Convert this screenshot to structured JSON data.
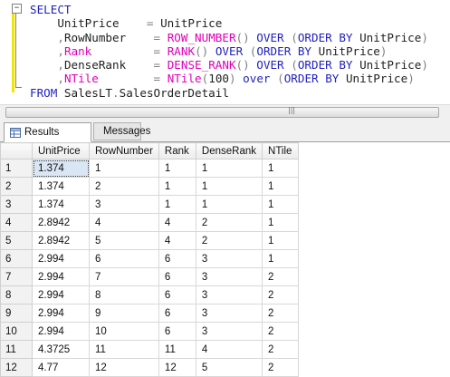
{
  "editor": {
    "lines": [
      [
        {
          "c": "kw",
          "t": "SELECT"
        }
      ],
      [
        {
          "c": "tx",
          "t": "    UnitPrice    "
        },
        {
          "c": "op",
          "t": "="
        },
        {
          "c": "tx",
          "t": " UnitPrice"
        }
      ],
      [
        {
          "c": "tx",
          "t": "    "
        },
        {
          "c": "op",
          "t": ","
        },
        {
          "c": "tx",
          "t": "RowNumber    "
        },
        {
          "c": "op",
          "t": "="
        },
        {
          "c": "tx",
          "t": " "
        },
        {
          "c": "fn",
          "t": "ROW_NUMBER"
        },
        {
          "c": "op",
          "t": "()"
        },
        {
          "c": "tx",
          "t": " "
        },
        {
          "c": "kw",
          "t": "OVER"
        },
        {
          "c": "tx",
          "t": " "
        },
        {
          "c": "op",
          "t": "("
        },
        {
          "c": "kw",
          "t": "ORDER BY"
        },
        {
          "c": "tx",
          "t": " UnitPrice"
        },
        {
          "c": "op",
          "t": ")"
        }
      ],
      [
        {
          "c": "tx",
          "t": "    "
        },
        {
          "c": "op",
          "t": ","
        },
        {
          "c": "fn",
          "t": "Rank"
        },
        {
          "c": "tx",
          "t": "         "
        },
        {
          "c": "op",
          "t": "="
        },
        {
          "c": "tx",
          "t": " "
        },
        {
          "c": "fn",
          "t": "RANK"
        },
        {
          "c": "op",
          "t": "()"
        },
        {
          "c": "tx",
          "t": " "
        },
        {
          "c": "kw",
          "t": "OVER"
        },
        {
          "c": "tx",
          "t": " "
        },
        {
          "c": "op",
          "t": "("
        },
        {
          "c": "kw",
          "t": "ORDER BY"
        },
        {
          "c": "tx",
          "t": " UnitPrice"
        },
        {
          "c": "op",
          "t": ")"
        }
      ],
      [
        {
          "c": "tx",
          "t": "    "
        },
        {
          "c": "op",
          "t": ","
        },
        {
          "c": "tx",
          "t": "DenseRank    "
        },
        {
          "c": "op",
          "t": "="
        },
        {
          "c": "tx",
          "t": " "
        },
        {
          "c": "fn",
          "t": "DENSE_RANK"
        },
        {
          "c": "op",
          "t": "()"
        },
        {
          "c": "tx",
          "t": " "
        },
        {
          "c": "kw",
          "t": "OVER"
        },
        {
          "c": "tx",
          "t": " "
        },
        {
          "c": "op",
          "t": "("
        },
        {
          "c": "kw",
          "t": "ORDER BY"
        },
        {
          "c": "tx",
          "t": " UnitPrice"
        },
        {
          "c": "op",
          "t": ")"
        }
      ],
      [
        {
          "c": "tx",
          "t": "    "
        },
        {
          "c": "op",
          "t": ","
        },
        {
          "c": "fn",
          "t": "NTile"
        },
        {
          "c": "tx",
          "t": "        "
        },
        {
          "c": "op",
          "t": "="
        },
        {
          "c": "tx",
          "t": " "
        },
        {
          "c": "fn",
          "t": "NTile"
        },
        {
          "c": "op",
          "t": "("
        },
        {
          "c": "tx",
          "t": "100"
        },
        {
          "c": "op",
          "t": ")"
        },
        {
          "c": "tx",
          "t": " "
        },
        {
          "c": "kw",
          "t": "over"
        },
        {
          "c": "tx",
          "t": " "
        },
        {
          "c": "op",
          "t": "("
        },
        {
          "c": "kw",
          "t": "ORDER BY"
        },
        {
          "c": "tx",
          "t": " UnitPrice"
        },
        {
          "c": "op",
          "t": ")"
        }
      ],
      [
        {
          "c": "kw",
          "t": "FROM"
        },
        {
          "c": "tx",
          "t": " SalesLT"
        },
        {
          "c": "op",
          "t": "."
        },
        {
          "c": "tx",
          "t": "SalesOrderDetail"
        }
      ]
    ],
    "collapse_glyph": "−"
  },
  "tabs": {
    "results_label": "Results",
    "messages_label": "Messages"
  },
  "grid": {
    "columns": [
      "UnitPrice",
      "RowNumber",
      "Rank",
      "DenseRank",
      "NTile"
    ],
    "rows": [
      [
        "1",
        "1.374",
        "1",
        "1",
        "1",
        "1"
      ],
      [
        "2",
        "1.374",
        "2",
        "1",
        "1",
        "1"
      ],
      [
        "3",
        "1.374",
        "3",
        "1",
        "1",
        "1"
      ],
      [
        "4",
        "2.8942",
        "4",
        "4",
        "2",
        "1"
      ],
      [
        "5",
        "2.8942",
        "5",
        "4",
        "2",
        "1"
      ],
      [
        "6",
        "2.994",
        "6",
        "6",
        "3",
        "1"
      ],
      [
        "7",
        "2.994",
        "7",
        "6",
        "3",
        "2"
      ],
      [
        "8",
        "2.994",
        "8",
        "6",
        "3",
        "2"
      ],
      [
        "9",
        "2.994",
        "9",
        "6",
        "3",
        "2"
      ],
      [
        "10",
        "2.994",
        "10",
        "6",
        "3",
        "2"
      ],
      [
        "11",
        "4.3725",
        "11",
        "11",
        "4",
        "2"
      ],
      [
        "12",
        "4.77",
        "12",
        "12",
        "5",
        "2"
      ]
    ]
  },
  "colors": {
    "keyword": "#1f1fbf",
    "function": "#e000b8",
    "selected_cell": "#dbe6f4"
  }
}
